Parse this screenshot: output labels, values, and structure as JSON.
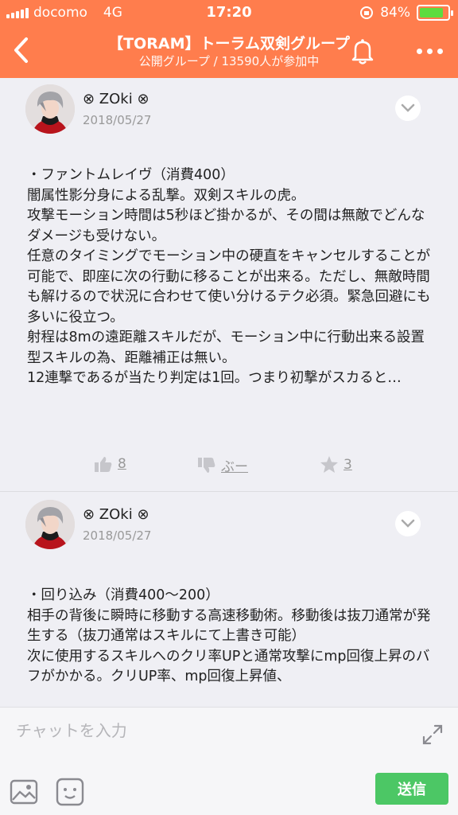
{
  "status_bar": {
    "carrier": "docomo",
    "network": "4G",
    "time": "17:20",
    "battery_percent": "84%",
    "battery_level": 0.84
  },
  "header": {
    "title": "【TORAM】トーラム双剣グループ",
    "subtitle": "公開グループ / 13590人が参加中",
    "back_icon": "chevron-left-icon",
    "bell_icon": "bell-icon",
    "more_icon": "more-dots-icon",
    "color": "#ff7d4d"
  },
  "posts": [
    {
      "author": "⊗ ZOki ⊗",
      "date": "2018/05/27",
      "body": "・ファントムレイヴ（消費400）\n闇属性影分身による乱撃。双剣スキルの虎。\n攻撃モーション時間は5秒ほど掛かるが、その間は無敵でどんなダメージも受けない。\n任意のタイミングでモーション中の硬直をキャンセルすることが可能で、即座に次の行動に移ることが出来る。ただし、無敵時間も解けるので状況に合わせて使い分けるテク必須。緊急回避にも多いに役立つ。\n射程は8mの遠距離スキルだが、モーション中に行動出来る設置型スキルの為、距離補正は無い。\n12連撃であるが当たり判定は1回。つまり初撃がスカると…",
      "likes": "8",
      "boo": "ぶー",
      "stars": "3"
    },
    {
      "author": "⊗ ZOki ⊗",
      "date": "2018/05/27",
      "body": "・回り込み（消費400〜200）\n相手の背後に瞬時に移動する高速移動術。移動後は抜刀通常が発生する（抜刀通常はスキルにて上書き可能）\n次に使用するスキルへのクリ率UPと通常攻撃にmp回復上昇のバフがかかる。クリUP率、mp回復上昇値、"
    }
  ],
  "composer": {
    "placeholder": "チャットを入力",
    "send_label": "送信",
    "send_color": "#4cc765"
  }
}
